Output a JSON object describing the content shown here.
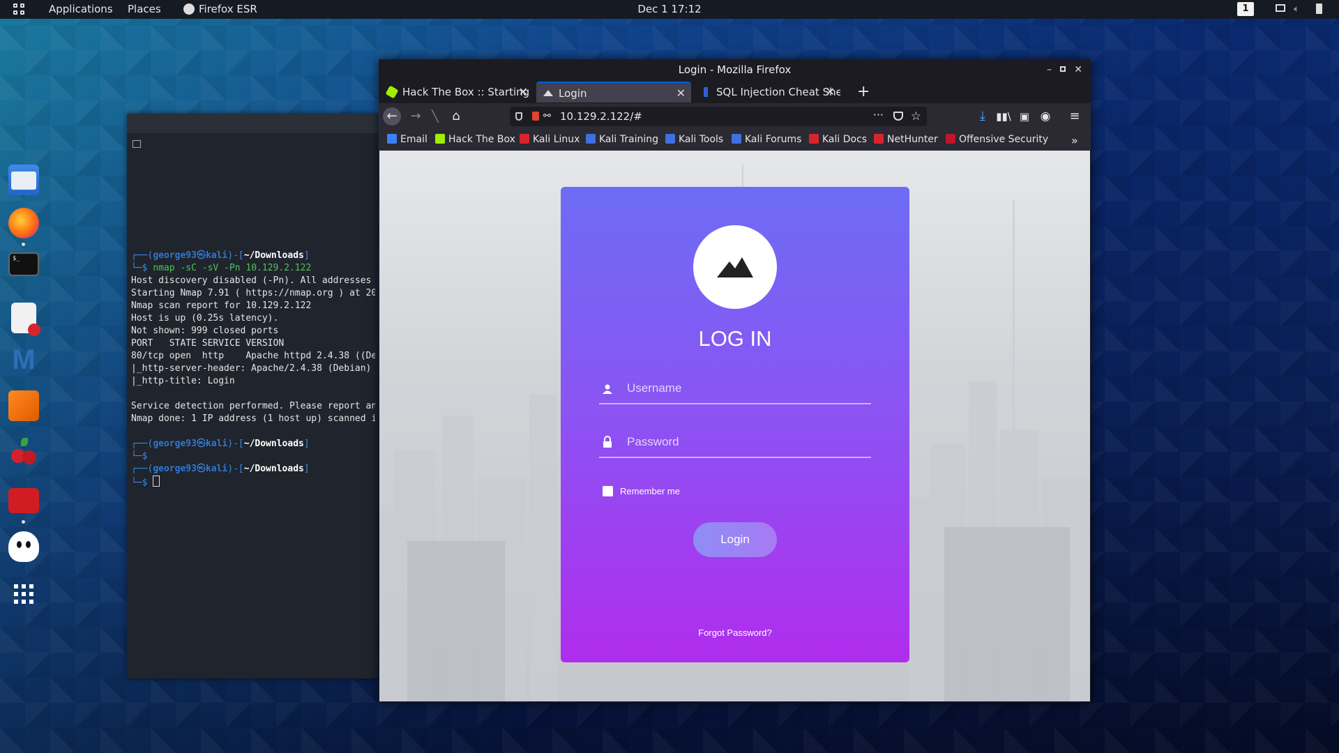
{
  "topbar": {
    "applications": "Applications",
    "places": "Places",
    "firefox": "Firefox ESR",
    "clock": "Dec 1  17:12",
    "workspace": "1"
  },
  "dock": {
    "icons": [
      "files-icon",
      "firefox-icon",
      "terminal-icon",
      "text-editor-icon",
      "metasploit-icon",
      "burpsuite-icon",
      "cherrytree-icon",
      "maltego-icon",
      "ghost-icon",
      "app-grid-icon"
    ]
  },
  "terminal": {
    "lines": [
      {
        "prompt_user": "george93",
        "prompt_host": "kali",
        "prompt_dir": "~/Downloads"
      },
      {
        "cmd": "nmap -sC -sV -Pn 10.129.2.122"
      },
      {
        "out": "Host discovery disabled (-Pn). All addresses"
      },
      {
        "out": "Starting Nmap 7.91 ( https://nmap.org ) at 20"
      },
      {
        "out": "Nmap scan report for 10.129.2.122"
      },
      {
        "out": "Host is up (0.25s latency)."
      },
      {
        "out": "Not shown: 999 closed ports"
      },
      {
        "out": "PORT   STATE SERVICE VERSION"
      },
      {
        "out": "80/tcp open  http    Apache httpd 2.4.38 ((De"
      },
      {
        "out": "|_http-server-header: Apache/2.4.38 (Debian)"
      },
      {
        "out": "|_http-title: Login"
      },
      {
        "out": ""
      },
      {
        "out": "Service detection performed. Please report an"
      },
      {
        "out": "Nmap done: 1 IP address (1 host up) scanned i"
      }
    ],
    "prompt2_user": "george93",
    "prompt2_host": "kali",
    "prompt2_dir": "~/Downloads",
    "prompt3_user": "george93",
    "prompt3_host": "kali",
    "prompt3_dir": "~/Downloads"
  },
  "firefox": {
    "window_title": "Login - Mozilla Firefox",
    "tabs": [
      {
        "label": "Hack The Box :: Starting P"
      },
      {
        "label": "Login"
      },
      {
        "label": "SQL Injection Cheat Shee"
      }
    ],
    "url": "10.129.2.122/#",
    "bookmarks": [
      "Email",
      "Hack The Box",
      "Kali Linux",
      "Kali Training",
      "Kali Tools",
      "Kali Forums",
      "Kali Docs",
      "NetHunter",
      "Offensive Security"
    ]
  },
  "login": {
    "title": "LOG IN",
    "username_placeholder": "Username",
    "password_placeholder": "Password",
    "remember_label": "Remember me",
    "button_label": "Login",
    "forgot_label": "Forgot Password?"
  },
  "colors": {
    "card_top": "#6d6cf5",
    "card_bottom": "#b02ded",
    "tab_accent": "#0060df"
  }
}
